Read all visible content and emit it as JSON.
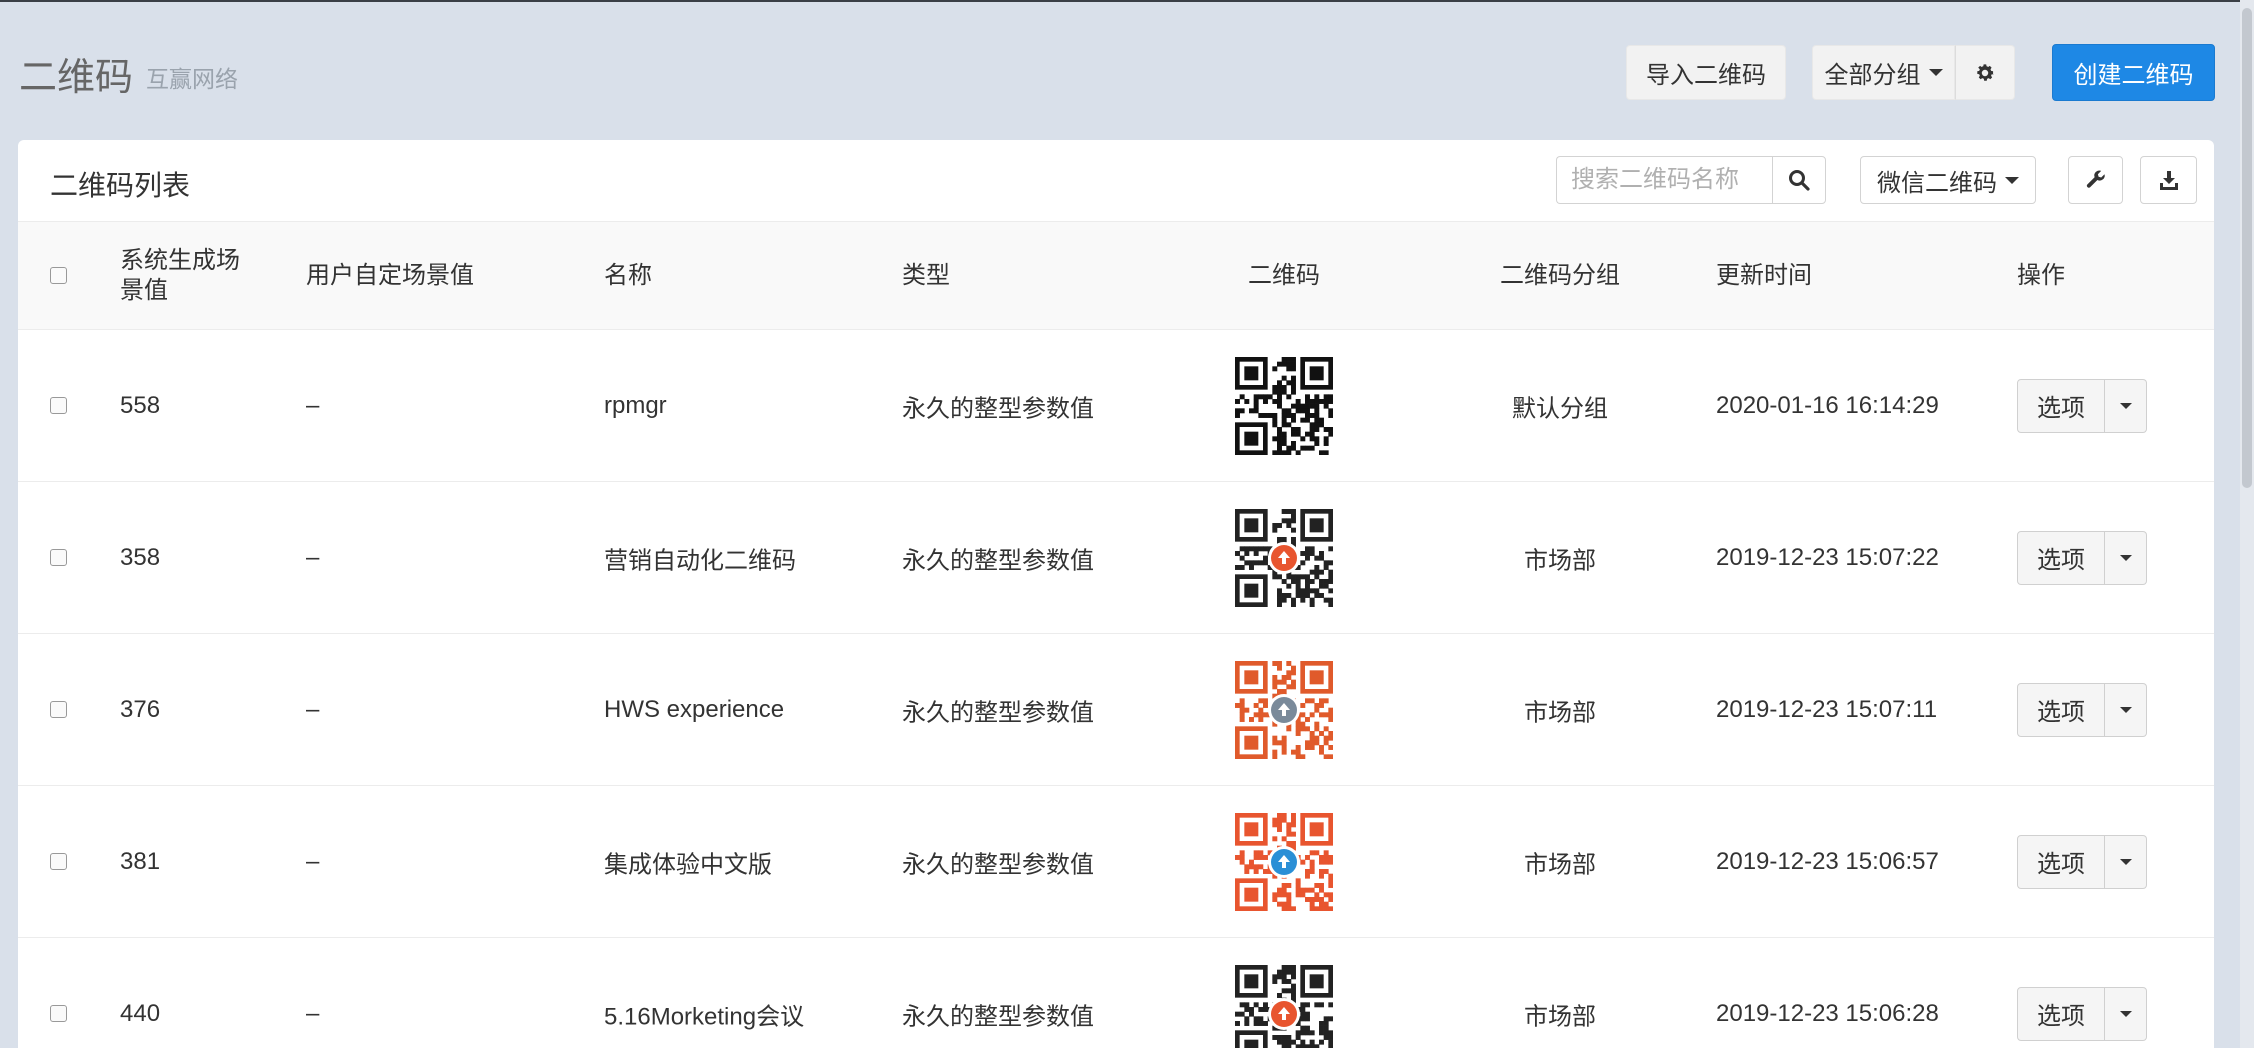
{
  "header": {
    "title": "二维码",
    "subtitle": "互赢网络",
    "import_label": "导入二维码",
    "group_label": "全部分组",
    "create_label": "创建二维码"
  },
  "panel": {
    "title": "二维码列表",
    "search_placeholder": "搜索二维码名称",
    "type_filter": "微信二维码"
  },
  "table": {
    "columns": {
      "sys_scene": "系统生成场景值",
      "user_scene": "用户自定场景值",
      "name": "名称",
      "type": "类型",
      "qrcode": "二维码",
      "group": "二维码分组",
      "updated": "更新时间",
      "actions": "操作"
    },
    "rows": [
      {
        "sys_scene": "558",
        "user_scene": "–",
        "name": "rpmgr",
        "type": "永久的整型参数值",
        "group": "默认分组",
        "updated": "2020-01-16 16:14:29",
        "action": "选项",
        "qr_color": "#111111",
        "qr_logo": ""
      },
      {
        "sys_scene": "358",
        "user_scene": "–",
        "name": "营销自动化二维码",
        "type": "永久的整型参数值",
        "group": "市场部",
        "updated": "2019-12-23 15:07:22",
        "action": "选项",
        "qr_color": "#222222",
        "qr_logo": "#e8552f"
      },
      {
        "sys_scene": "376",
        "user_scene": "–",
        "name": "HWS experience",
        "type": "永久的整型参数值",
        "group": "市场部",
        "updated": "2019-12-23 15:07:11",
        "action": "选项",
        "qr_color": "#e05a2b",
        "qr_logo": "#7a8a9a"
      },
      {
        "sys_scene": "381",
        "user_scene": "–",
        "name": "集成体验中文版",
        "type": "永久的整型参数值",
        "group": "市场部",
        "updated": "2019-12-23 15:06:57",
        "action": "选项",
        "qr_color": "#e8552f",
        "qr_logo": "#2a8fd6"
      },
      {
        "sys_scene": "440",
        "user_scene": "–",
        "name": "5.16Morketing会议",
        "type": "永久的整型参数值",
        "group": "市场部",
        "updated": "2019-12-23 15:06:28",
        "action": "选项",
        "qr_color": "#222222",
        "qr_logo": "#e8552f"
      }
    ]
  },
  "icons": {
    "gear": "gear-icon",
    "search": "search-icon",
    "wrench": "wrench-icon",
    "download": "download-icon"
  }
}
